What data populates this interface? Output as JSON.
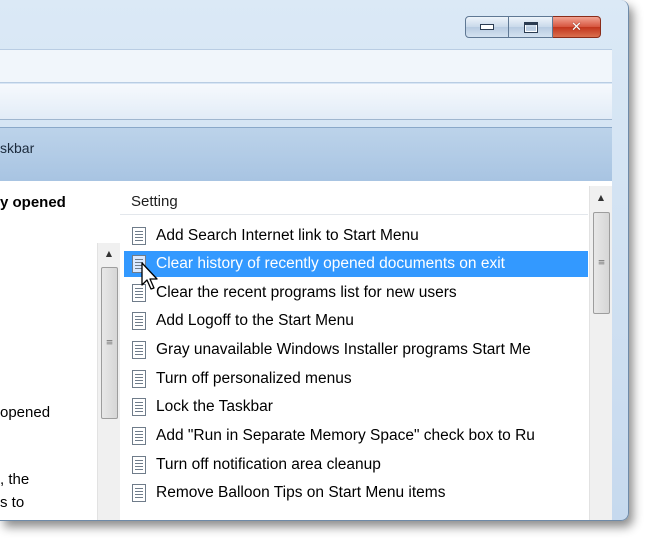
{
  "window": {
    "caption_buttons": {
      "minimize": "–",
      "maximize": "□",
      "close": "✕"
    },
    "close_color": "#c7432a"
  },
  "header": {
    "title_fragment": "skbar"
  },
  "left_pane": {
    "heading_fragment": "y opened",
    "lines": [
      "opened",
      ", the",
      "s to"
    ]
  },
  "list": {
    "column_header": "Setting",
    "selected_color": "#3399ff",
    "items": [
      {
        "label": "Add Search Internet link to Start Menu",
        "selected": false
      },
      {
        "label": "Clear history of recently opened documents on exit",
        "selected": true
      },
      {
        "label": "Clear the recent programs list for new users",
        "selected": false
      },
      {
        "label": "Add Logoff to the Start Menu",
        "selected": false
      },
      {
        "label": "Gray unavailable Windows Installer programs Start Me",
        "selected": false
      },
      {
        "label": "Turn off personalized menus",
        "selected": false
      },
      {
        "label": "Lock the Taskbar",
        "selected": false
      },
      {
        "label": "Add \"Run in Separate Memory Space\" check box to Ru",
        "selected": false
      },
      {
        "label": "Turn off notification area cleanup",
        "selected": false
      },
      {
        "label": "Remove Balloon Tips on Start Menu items",
        "selected": false
      }
    ]
  },
  "icons": {
    "setting_item": "policy-setting-icon",
    "scroll_up": "scroll-up-arrow-icon",
    "scroll_grip": "scroll-grip-icon",
    "cursor": "mouse-pointer-icon"
  }
}
